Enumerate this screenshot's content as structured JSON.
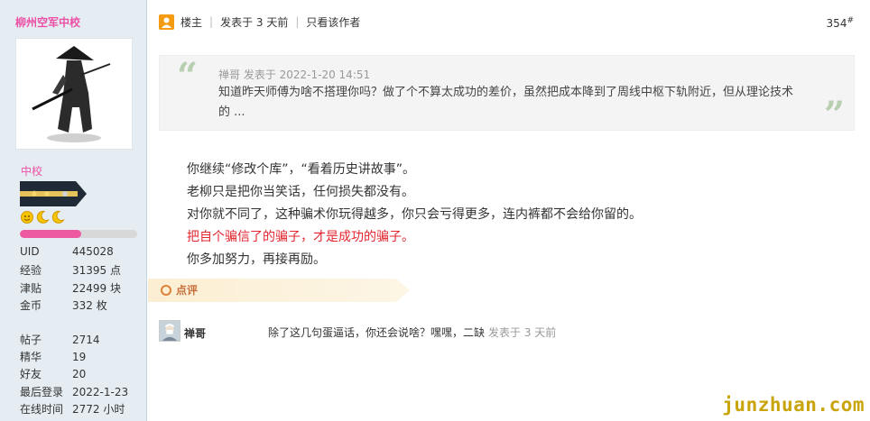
{
  "sidebar": {
    "username": "柳州空军中校",
    "rank": "中校",
    "level_progress": 0.52,
    "stats_a": [
      {
        "key": "UID",
        "value": "445028"
      },
      {
        "key": "经验",
        "value": "31395 点"
      },
      {
        "key": "津贴",
        "value": "22499 块"
      },
      {
        "key": "金币",
        "value": "332 枚"
      }
    ],
    "stats_b": [
      {
        "key": "帖子",
        "value": "2714"
      },
      {
        "key": "精华",
        "value": "19"
      },
      {
        "key": "好友",
        "value": "20"
      },
      {
        "key": "最后登录",
        "value": "2022-1-23"
      },
      {
        "key": "在线时间",
        "value": "2772 小时"
      }
    ]
  },
  "post": {
    "header": {
      "author_label": "楼主",
      "time": "发表于 3 天前",
      "only_author": "只看该作者"
    },
    "floor_number": "354",
    "floor_suffix": "#",
    "quote": {
      "meta": "禅哥 发表于 2022-1-20 14:51",
      "text": "知道昨天师傅为啥不搭理你吗？做了个不算太成功的差价，虽然把成本降到了周线中枢下轨附近，但从理论技术的 ..."
    },
    "content": [
      {
        "text": "你继续“修改个库”，“看着历史讲故事”。",
        "red": false
      },
      {
        "text": "老柳只是把你当笑话，任何损失都没有。",
        "red": false
      },
      {
        "text": "对你就不同了，这种骗术你玩得越多，你只会亏得更多，连内裤都不会给你留的。",
        "red": false
      },
      {
        "text": "把自个骗信了的骗子，才是成功的骗子。",
        "red": true
      },
      {
        "text": "你多加努力，再接再励。",
        "red": false
      }
    ],
    "comment_tab": "点评",
    "comment": {
      "user": "禅哥",
      "text": "除了这几句蛋逼话，你还会说啥？嘿嘿，二缺",
      "time": "发表于 3 天前"
    }
  },
  "watermark": "junzhuan.com",
  "colors": {
    "sidebar_bg": "#e5edf2",
    "pink": "#ec4fa5",
    "red_text": "#e2252f",
    "quote_mark": "#b8ceb0",
    "watermark": "#c9a40a"
  }
}
